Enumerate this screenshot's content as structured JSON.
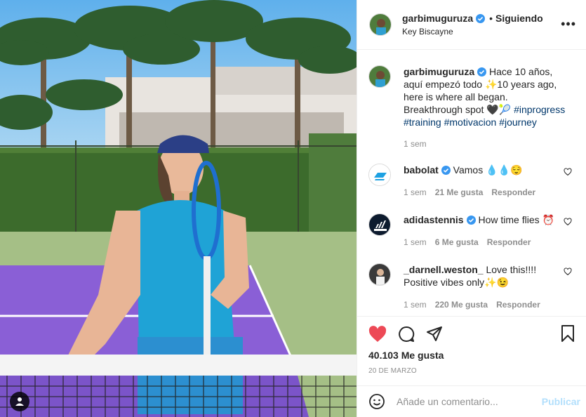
{
  "post": {
    "username": "garbimuguruza",
    "follow_label": "Siguiendo",
    "dot": "•",
    "location": "Key Biscayne",
    "more_label": "•••",
    "caption_text": "Hace 10 años, aquí empezó todo ✨10 years ago, here is where all began. Breakthrough spot 🖤🎾",
    "hashtags": [
      "#inprogress",
      "#training",
      "#motivacion",
      "#journey"
    ],
    "caption_time": "1 sem"
  },
  "comments": [
    {
      "username": "babolat",
      "verified": true,
      "text": "Vamos 💧💧😌",
      "time": "1 sem",
      "likes": "21 Me gusta",
      "reply": "Responder"
    },
    {
      "username": "adidastennis",
      "verified": true,
      "text": "How time flies ⏰",
      "time": "1 sem",
      "likes": "6 Me gusta",
      "reply": "Responder"
    },
    {
      "username": "_darnell.weston_",
      "verified": false,
      "text": "Love this!!!! Positive vibes only✨😉",
      "time": "1 sem",
      "likes": "220 Me gusta",
      "reply": "Responder"
    }
  ],
  "stats": {
    "likes": "40.103 Me gusta",
    "date": "20 DE MARZO"
  },
  "composer": {
    "placeholder": "Añade un comentario...",
    "publish_label": "Publicar"
  },
  "icons": {
    "like": "heart-filled-icon",
    "comment": "comment-icon",
    "share": "share-icon",
    "save": "bookmark-icon",
    "emoji": "emoji-icon",
    "user_tag": "user-tag-icon",
    "verified": "verified-badge-icon"
  },
  "colors": {
    "like_red": "#ed4956",
    "verified_blue": "#3897f0",
    "hashtag_blue": "#00376b",
    "publish_disabled": "#b2dffc",
    "secondary_text": "#8e8e8e"
  }
}
